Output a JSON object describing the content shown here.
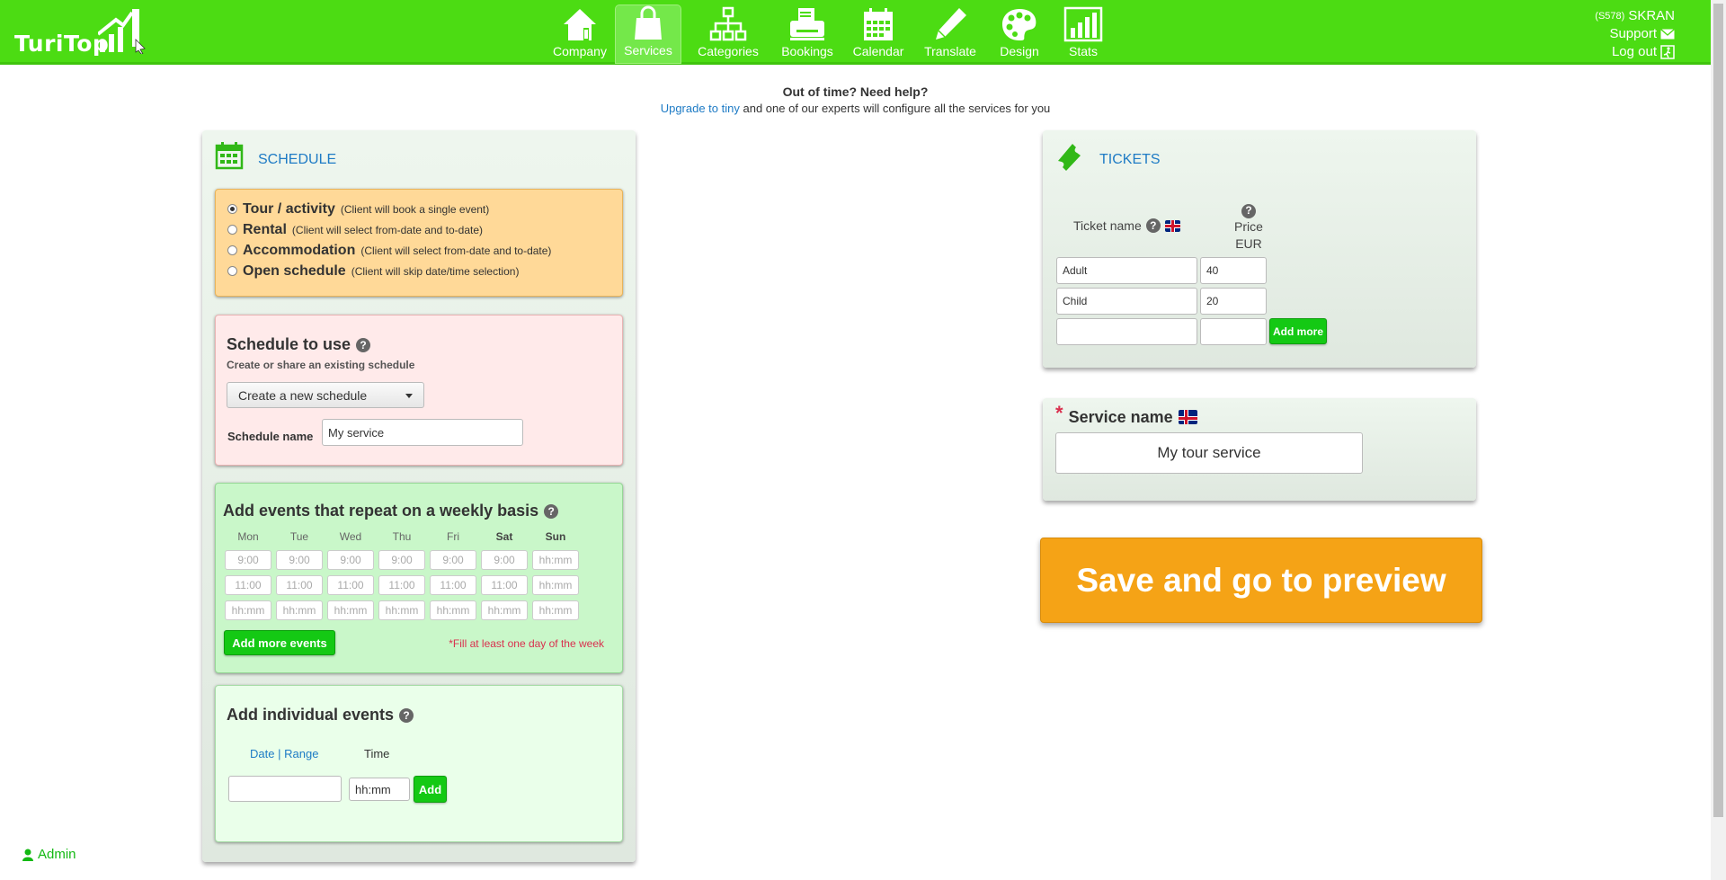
{
  "header": {
    "logo_text": "TuriTop",
    "nav": [
      {
        "label": "Company",
        "icon": "home-icon"
      },
      {
        "label": "Services",
        "icon": "shopping-bag-icon",
        "active": true
      },
      {
        "label": "Categories",
        "icon": "hierarchy-icon"
      },
      {
        "label": "Bookings",
        "icon": "printer-icon"
      },
      {
        "label": "Calendar",
        "icon": "calendar-icon"
      },
      {
        "label": "Translate",
        "icon": "pencil-icon"
      },
      {
        "label": "Design",
        "icon": "palette-icon"
      },
      {
        "label": "Stats",
        "icon": "bar-chart-icon"
      }
    ],
    "user_id": "(S578)",
    "user_name": "SKRAN",
    "support": "Support",
    "logout": "Log out",
    "accent_color": "#4cdc13"
  },
  "help": {
    "question": "Out of time? Need help?",
    "link": "Upgrade to tiny",
    "rest": " and one of our experts will configure all the services for you"
  },
  "schedule": {
    "title": "SCHEDULE",
    "types": [
      {
        "label": "Tour / activity",
        "desc": "(Client will book a single event)",
        "selected": true
      },
      {
        "label": "Rental",
        "desc": "(Client will select from-date and to-date)",
        "selected": false
      },
      {
        "label": "Accommodation",
        "desc": "(Client will select from-date and to-date)",
        "selected": false
      },
      {
        "label": "Open schedule",
        "desc": "(Client will skip date/time selection)",
        "selected": false
      }
    ],
    "schedule_to_use": {
      "title": "Schedule to use",
      "subtitle": "Create or share an existing schedule",
      "dropdown_value": "Create a new schedule",
      "name_label": "Schedule name",
      "name_value": "My service"
    },
    "weekly": {
      "title": "Add events that repeat on a weekly basis",
      "days": [
        "Mon",
        "Tue",
        "Wed",
        "Thu",
        "Fri",
        "Sat",
        "Sun"
      ],
      "rows": [
        [
          "9:00",
          "9:00",
          "9:00",
          "9:00",
          "9:00",
          "9:00",
          "hh:mm"
        ],
        [
          "11:00",
          "11:00",
          "11:00",
          "11:00",
          "11:00",
          "11:00",
          "hh:mm"
        ],
        [
          "hh:mm",
          "hh:mm",
          "hh:mm",
          "hh:mm",
          "hh:mm",
          "hh:mm",
          "hh:mm"
        ]
      ],
      "add_button": "Add more events",
      "warning": "*Fill at least one day of the week"
    },
    "individual": {
      "title": "Add individual events",
      "date_label": "Date",
      "range_label": "Range",
      "separator": "|",
      "time_label": "Time",
      "time_placeholder": "hh:mm",
      "add_button": "Add"
    }
  },
  "tickets": {
    "title": "TICKETS",
    "col_name": "Ticket name",
    "col_price": "Price",
    "col_currency": "EUR",
    "rows": [
      {
        "name": "Adult",
        "price": "40"
      },
      {
        "name": "Child",
        "price": "20"
      },
      {
        "name": "",
        "price": ""
      }
    ],
    "add_more": "Add more"
  },
  "service": {
    "required_mark": "*",
    "label": "Service name",
    "value": "My tour service"
  },
  "save_button": "Save and go to preview",
  "admin": "Admin"
}
